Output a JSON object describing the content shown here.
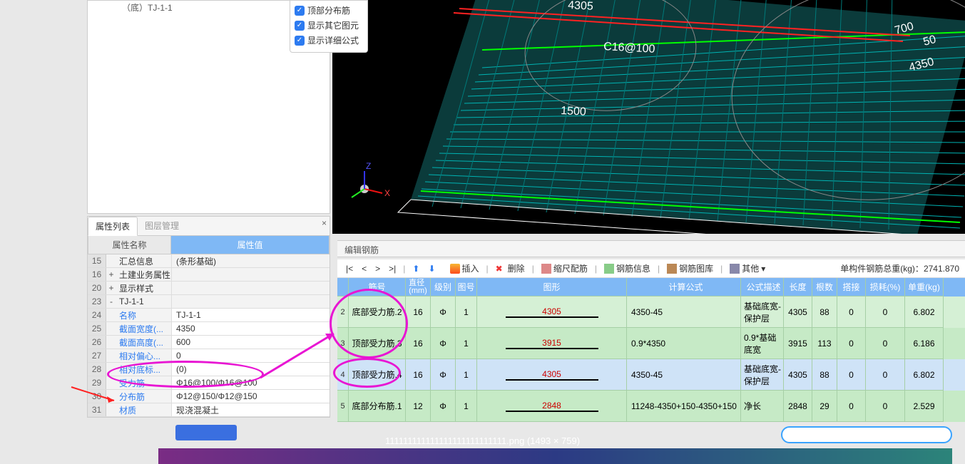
{
  "tree": {
    "item": "（底）TJ-1-1"
  },
  "overlay": {
    "opt1": "顶部分布筋",
    "opt2": "显示其它图元",
    "opt3": "显示详细公式"
  },
  "viewport": {
    "dim_top": "4305",
    "dim_tag": "C16@100",
    "dim_r1": "700",
    "dim_r2": "50",
    "dim_r3": "4350",
    "dim_mid": "1500",
    "axis_x": "X",
    "axis_z": "Z"
  },
  "prop": {
    "tab_active": "属性列表",
    "tab_other": "图层管理",
    "head_name": "属性名称",
    "head_value": "属性值",
    "rows": {
      "r15": {
        "n": "15",
        "name": "汇总信息",
        "value": "(条形基础)"
      },
      "r16": {
        "n": "16",
        "ex": "+",
        "name": "土建业务属性",
        "value": ""
      },
      "r20": {
        "n": "20",
        "ex": "+",
        "name": "显示样式",
        "value": ""
      },
      "r23": {
        "n": "23",
        "ex": "-",
        "name": "TJ-1-1",
        "value": ""
      },
      "r24": {
        "n": "24",
        "name": "名称",
        "value": "TJ-1-1"
      },
      "r25": {
        "n": "25",
        "name": "截面宽度(...",
        "value": "4350"
      },
      "r26": {
        "n": "26",
        "name": "截面高度(...",
        "value": "600"
      },
      "r27": {
        "n": "27",
        "name": "相对偏心...",
        "value": "0"
      },
      "r28": {
        "n": "28",
        "name": "相对底标...",
        "value": "(0)"
      },
      "r29": {
        "n": "29",
        "name": "受力筋",
        "value": "Φ16@100/Φ16@100"
      },
      "r30": {
        "n": "30",
        "name": "分布筋",
        "value": "Φ12@150/Φ12@150"
      },
      "r31": {
        "n": "31",
        "name": "材质",
        "value": "现浇混凝土"
      }
    }
  },
  "edit": {
    "title": "编辑钢筋",
    "nav_first": "|<",
    "nav_prev": "<",
    "nav_next": ">",
    "nav_last": ">|",
    "btn_insert": "插入",
    "btn_delete": "删除",
    "btn_scale": "缩尺配筋",
    "btn_info": "钢筋信息",
    "btn_lib": "钢筋图库",
    "btn_other": "其他",
    "total_label": "单构件钢筋总重(kg)：",
    "total_value": "2741.870"
  },
  "tbl": {
    "head": {
      "name": "筋号",
      "dia": "直径\n(mm)",
      "lvl": "级别",
      "tno": "图号",
      "shape": "图形",
      "formula": "计算公式",
      "desc": "公式描述",
      "len": "长度",
      "qty": "根数",
      "lap": "搭接",
      "loss": "损耗(%)",
      "uw": "单重(kg)"
    },
    "rows": [
      {
        "idx": "2",
        "name": "底部受力筋.2",
        "dia": "16",
        "lvl": "Φ",
        "tno": "1",
        "shape": "4305",
        "formula": "4350-45",
        "desc": "基础底宽-保护层",
        "len": "4305",
        "qty": "88",
        "lap": "0",
        "loss": "0",
        "uw": "6.802"
      },
      {
        "idx": "3",
        "name": "顶部受力筋.3",
        "dia": "16",
        "lvl": "Φ",
        "tno": "1",
        "shape": "3915",
        "formula": "0.9*4350",
        "desc": "0.9*基础底宽",
        "len": "3915",
        "qty": "113",
        "lap": "0",
        "loss": "0",
        "uw": "6.186"
      },
      {
        "idx": "4",
        "name": "顶部受力筋.4",
        "dia": "16",
        "lvl": "Φ",
        "tno": "1",
        "shape": "4305",
        "formula": "4350-45",
        "desc": "基础底宽-保护层",
        "len": "4305",
        "qty": "88",
        "lap": "0",
        "loss": "0",
        "uw": "6.802",
        "sel": true
      },
      {
        "idx": "5",
        "name": "底部分布筋.1",
        "dia": "12",
        "lvl": "Φ",
        "tno": "1",
        "shape": "2848",
        "formula": "11248-4350+150-4350+150",
        "desc": "净长",
        "len": "2848",
        "qty": "29",
        "lap": "0",
        "loss": "0",
        "uw": "2.529"
      }
    ]
  },
  "footer": {
    "caption": "111111111111111111111111111.png (1493 × 759)"
  }
}
